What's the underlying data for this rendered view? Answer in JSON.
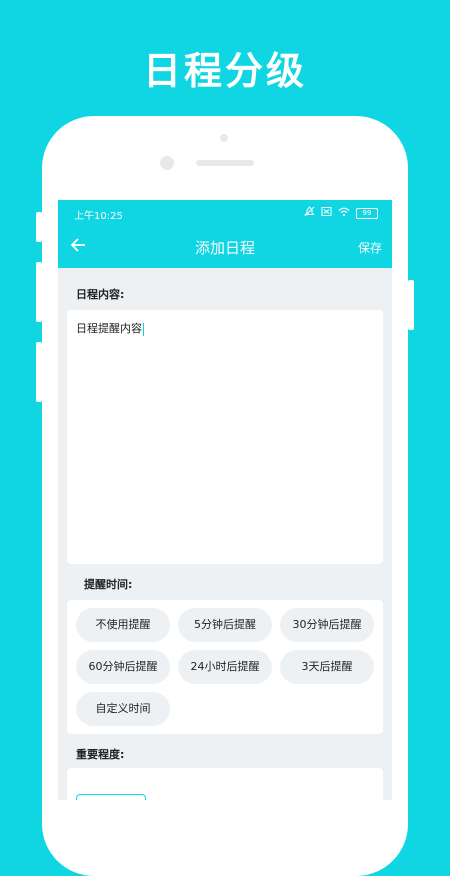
{
  "promo": {
    "title": "日程分级"
  },
  "status_bar": {
    "time": "上午10:25",
    "battery": "99"
  },
  "navbar": {
    "back_icon": "arrow-left-icon",
    "title": "添加日程",
    "save_label": "保存"
  },
  "content": {
    "label": "日程内容:",
    "value": "日程提醒内容"
  },
  "reminder": {
    "label": "提醒时间:",
    "options": [
      "不使用提醒",
      "5分钟后提醒",
      "30分钟后提醒",
      "60分钟后提醒",
      "24小时后提醒",
      "3天后提醒",
      "自定义时间"
    ]
  },
  "importance": {
    "label": "重要程度:"
  },
  "colors": {
    "accent": "#10d6e3",
    "screen_bg": "#eef1f4",
    "chip_bg": "#eef1f4"
  }
}
